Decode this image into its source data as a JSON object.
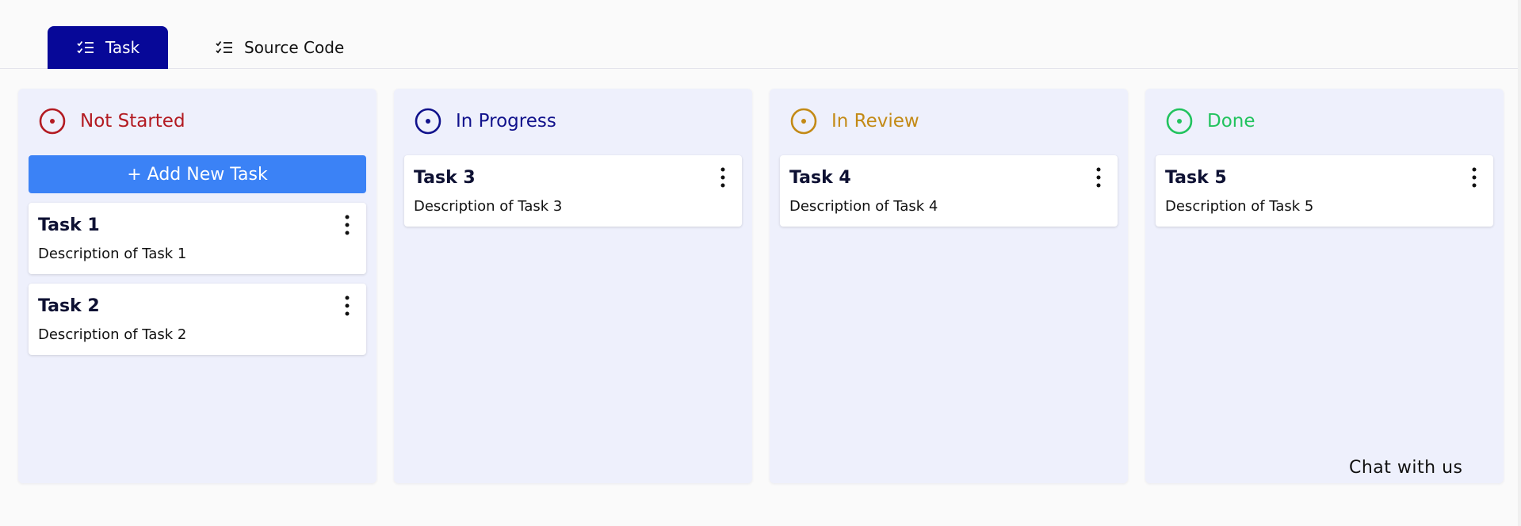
{
  "tabs": [
    {
      "label": "Task",
      "icon": "checklist-icon",
      "active": true
    },
    {
      "label": "Source Code",
      "icon": "checklist-icon",
      "active": false
    }
  ],
  "colors": {
    "tab_active": "#070898",
    "not_started": "#b31b22",
    "in_progress": "#11128c",
    "in_review": "#c38a16",
    "done": "#22c35e",
    "add_button": "#3b82f6",
    "column_bg": "#eef0fc"
  },
  "columns": [
    {
      "title": "Not Started",
      "icon": "status-circle-icon",
      "add_button": "+ Add New Task",
      "tasks": [
        {
          "title": "Task 1",
          "description": "Description of Task 1"
        },
        {
          "title": "Task 2",
          "description": "Description of Task 2"
        }
      ]
    },
    {
      "title": "In Progress",
      "icon": "status-circle-icon",
      "tasks": [
        {
          "title": "Task 3",
          "description": "Description of Task 3"
        }
      ]
    },
    {
      "title": "In Review",
      "icon": "status-circle-icon",
      "tasks": [
        {
          "title": "Task 4",
          "description": "Description of Task 4"
        }
      ]
    },
    {
      "title": "Done",
      "icon": "status-circle-icon",
      "tasks": [
        {
          "title": "Task 5",
          "description": "Description of Task 5"
        }
      ]
    }
  ],
  "chat": {
    "label": "Chat with us"
  }
}
